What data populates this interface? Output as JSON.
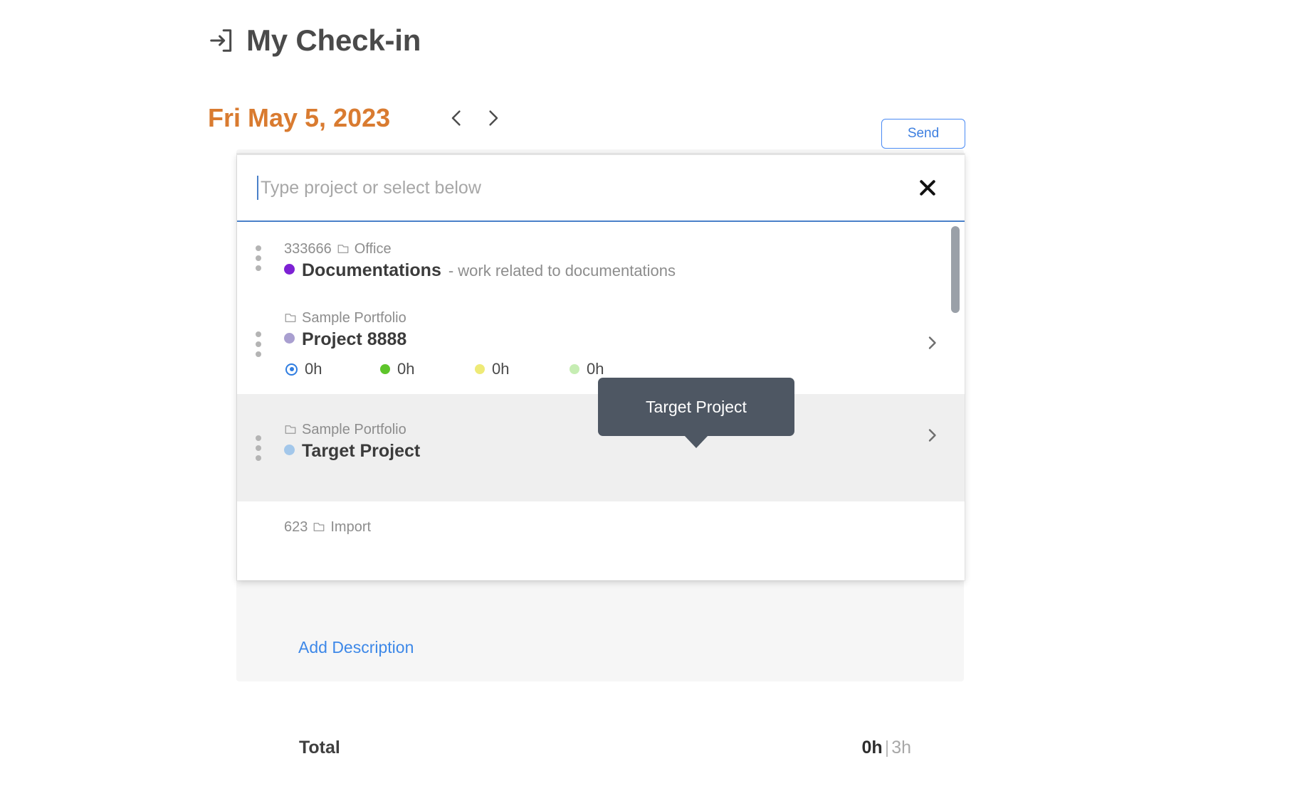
{
  "header": {
    "title": "My Check-in",
    "icon": "login-arrow-icon"
  },
  "datebar": {
    "date": "Fri May 5, 2023",
    "prev_icon": "chevron-left-icon",
    "next_icon": "chevron-right-icon",
    "send_label": "Send"
  },
  "dropdown": {
    "input_value": "",
    "placeholder": "Type project or select below",
    "close_icon": "close-icon",
    "items": [
      {
        "code": "333666",
        "folder": "Office",
        "dot_color": "#7d21d4",
        "name": "Documentations",
        "description": "- work related to documentations",
        "has_chevron": false,
        "highlight": false,
        "times": []
      },
      {
        "code": "",
        "folder": "Sample Portfolio",
        "dot_color": "#a99fd0",
        "name": "Project 8888",
        "description": "",
        "has_chevron": true,
        "highlight": false,
        "times": [
          {
            "icon": "target-ring-icon",
            "color": "#2f7de1",
            "value": "0h"
          },
          {
            "icon": "dot-icon",
            "color": "#5ec52b",
            "value": "0h"
          },
          {
            "icon": "dot-icon",
            "color": "#eeea77",
            "value": "0h"
          },
          {
            "icon": "dot-icon",
            "color": "#c6edb3",
            "value": "0h"
          }
        ]
      },
      {
        "code": "",
        "folder": "Sample Portfolio",
        "dot_color": "#a3c7ea",
        "name": "Target Project",
        "description": "",
        "has_chevron": true,
        "highlight": true,
        "times": []
      },
      {
        "code": "623",
        "folder": "Import",
        "dot_color": "#cccccc",
        "name": "",
        "description": "",
        "has_chevron": true,
        "highlight": false,
        "times": []
      }
    ]
  },
  "tooltip": {
    "text": "Target Project"
  },
  "entry": {
    "add_description_label": "Add Description"
  },
  "total": {
    "label": "Total",
    "value": "0h",
    "separator": "|",
    "budget": "3h"
  },
  "colors": {
    "accent_orange": "#d97b30",
    "link_blue": "#3d88e8",
    "tooltip_bg": "#4e5763"
  }
}
